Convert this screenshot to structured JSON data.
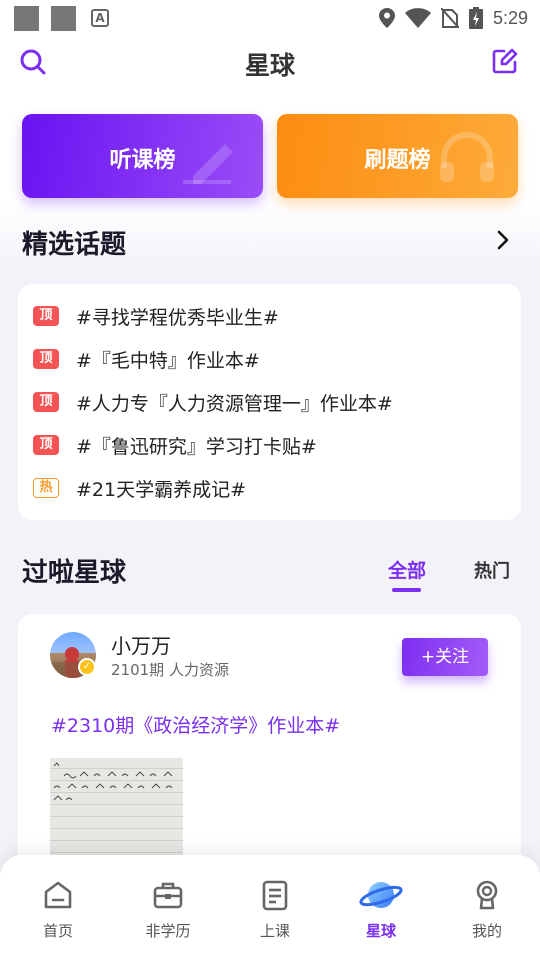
{
  "status_bar": {
    "time": "5:29"
  },
  "header": {
    "title": "星球"
  },
  "banners": {
    "listen_label": "听课榜",
    "practice_label": "刷题榜"
  },
  "topics": {
    "title": "精选话题",
    "items": [
      {
        "tag": "顶",
        "text": "#寻找学程优秀毕业生#"
      },
      {
        "tag": "顶",
        "text": "#『毛中特』作业本#"
      },
      {
        "tag": "顶",
        "text": "#人力专『人力资源管理一』作业本#"
      },
      {
        "tag": "顶",
        "text": "#『鲁迅研究』学习打卡贴#"
      },
      {
        "tag": "热",
        "text": "#21天学霸养成记#"
      }
    ]
  },
  "feed": {
    "title": "过啦星球",
    "tabs": [
      {
        "label": "全部",
        "active": true
      },
      {
        "label": "热门",
        "active": false
      }
    ],
    "post": {
      "user_name": "小万万",
      "user_meta": "2101期 人力资源",
      "follow_label": "+关注",
      "topic": "#2310期《政治经济学》作业本#"
    }
  },
  "bottom_nav": {
    "items": [
      {
        "label": "首页",
        "icon": "home-icon"
      },
      {
        "label": "非学历",
        "icon": "briefcase-icon"
      },
      {
        "label": "上课",
        "icon": "document-icon"
      },
      {
        "label": "星球",
        "icon": "planet-icon",
        "active": true
      },
      {
        "label": "我的",
        "icon": "profile-icon"
      }
    ]
  },
  "colors": {
    "accent": "#7b2ff0",
    "orange": "#fd8c10",
    "top_tag": "#f55455",
    "hot_tag": "#fa9a2b"
  }
}
